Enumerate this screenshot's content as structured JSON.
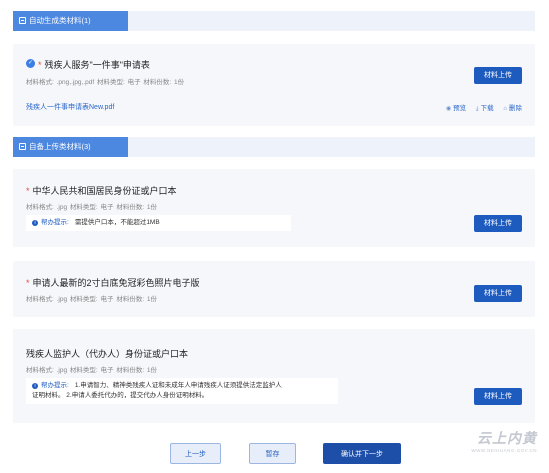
{
  "sections": {
    "auto": {
      "title": "自动生成类材料(1)"
    },
    "self": {
      "title": "自备上传类材料(3)"
    }
  },
  "auto_material": {
    "title": "残疾人服务\"一件事\"申请表",
    "meta": "材料格式: .png,.jpg,.pdf  材料类型: 电子  材料份数: 1份",
    "upload_label": "材料上传",
    "file_name": "残疾人一件事申请表New.pdf",
    "actions": {
      "preview": "预览",
      "download": "下载",
      "delete": "删除"
    }
  },
  "materials": [
    {
      "title": "中华人民共和国居民身份证或户口本",
      "meta": "材料格式: .jpg  材料类型: 电子  材料份数: 1份",
      "tip_label": "帮办提示:",
      "tip_text": "需提供户口本，不能超过1MB",
      "upload_label": "材料上传"
    },
    {
      "title": "申请人最新的2寸白底免冠彩色照片电子版",
      "meta": "材料格式: .jpg  材料类型: 电子  材料份数: 1份",
      "upload_label": "材料上传"
    },
    {
      "title": "残疾人监护人（代办人）身份证或户口本",
      "meta": "材料格式: .jpg  材料类型: 电子  材料份数: 1份",
      "tip_label": "帮办提示:",
      "tip_text_line1": "1.申请智力、精神类残疾人证和未成年人申请残疾人证须提供法定监护人",
      "tip_text_line2": "证明材料。 2.申请人委托代办的，提交代办人身份证明材料。",
      "upload_label": "材料上传"
    }
  ],
  "footer": {
    "prev": "上一步",
    "save": "暂存",
    "next": "确认并下一步"
  },
  "watermark": {
    "main": "云上内黄",
    "sub": "WWW.NEIHUANG.GOV.CN"
  },
  "colors": {
    "accent": "#1e5bbf",
    "tab": "#4c87e0",
    "required": "#e24a3c",
    "card_bg": "#f5f7fb"
  }
}
